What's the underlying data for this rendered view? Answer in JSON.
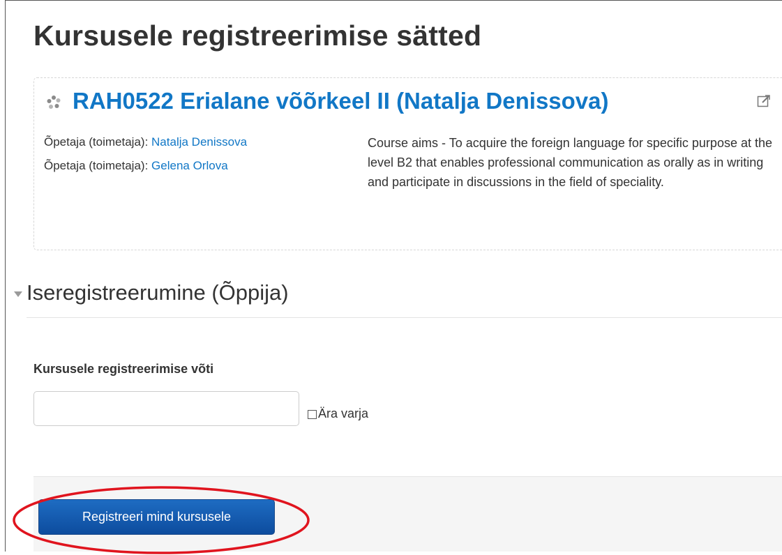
{
  "page": {
    "title": "Kursusele registreerimise sätted"
  },
  "course": {
    "name": "RAH0522 Erialane võõrkeel II (Natalja Denissova)",
    "teachers": [
      {
        "role": "Õpetaja (toimetaja):",
        "name": "Natalja Denissova"
      },
      {
        "role": "Õpetaja (toimetaja):",
        "name": "Gelena Orlova"
      }
    ],
    "summary": "Course aims - To acquire the foreign language for specific purpose at the level B2 that enables professional communication as orally as in writing and participate in discussions in the field of speciality."
  },
  "enrolment": {
    "section_title": "Iseregistreerumine (Õppija)",
    "key_label": "Kursusele registreerimise võti",
    "key_value": "",
    "unmask_label": "Ära varja",
    "unmask_checked": false,
    "submit_label": "Registreeri mind kursusele"
  },
  "colors": {
    "link": "#1177c6",
    "button": "#1565b8",
    "annotation": "#e0141e"
  },
  "icons": {
    "course": "course-icon",
    "edit": "external-edit-icon",
    "section_toggle": "collapse-triangle-icon"
  }
}
